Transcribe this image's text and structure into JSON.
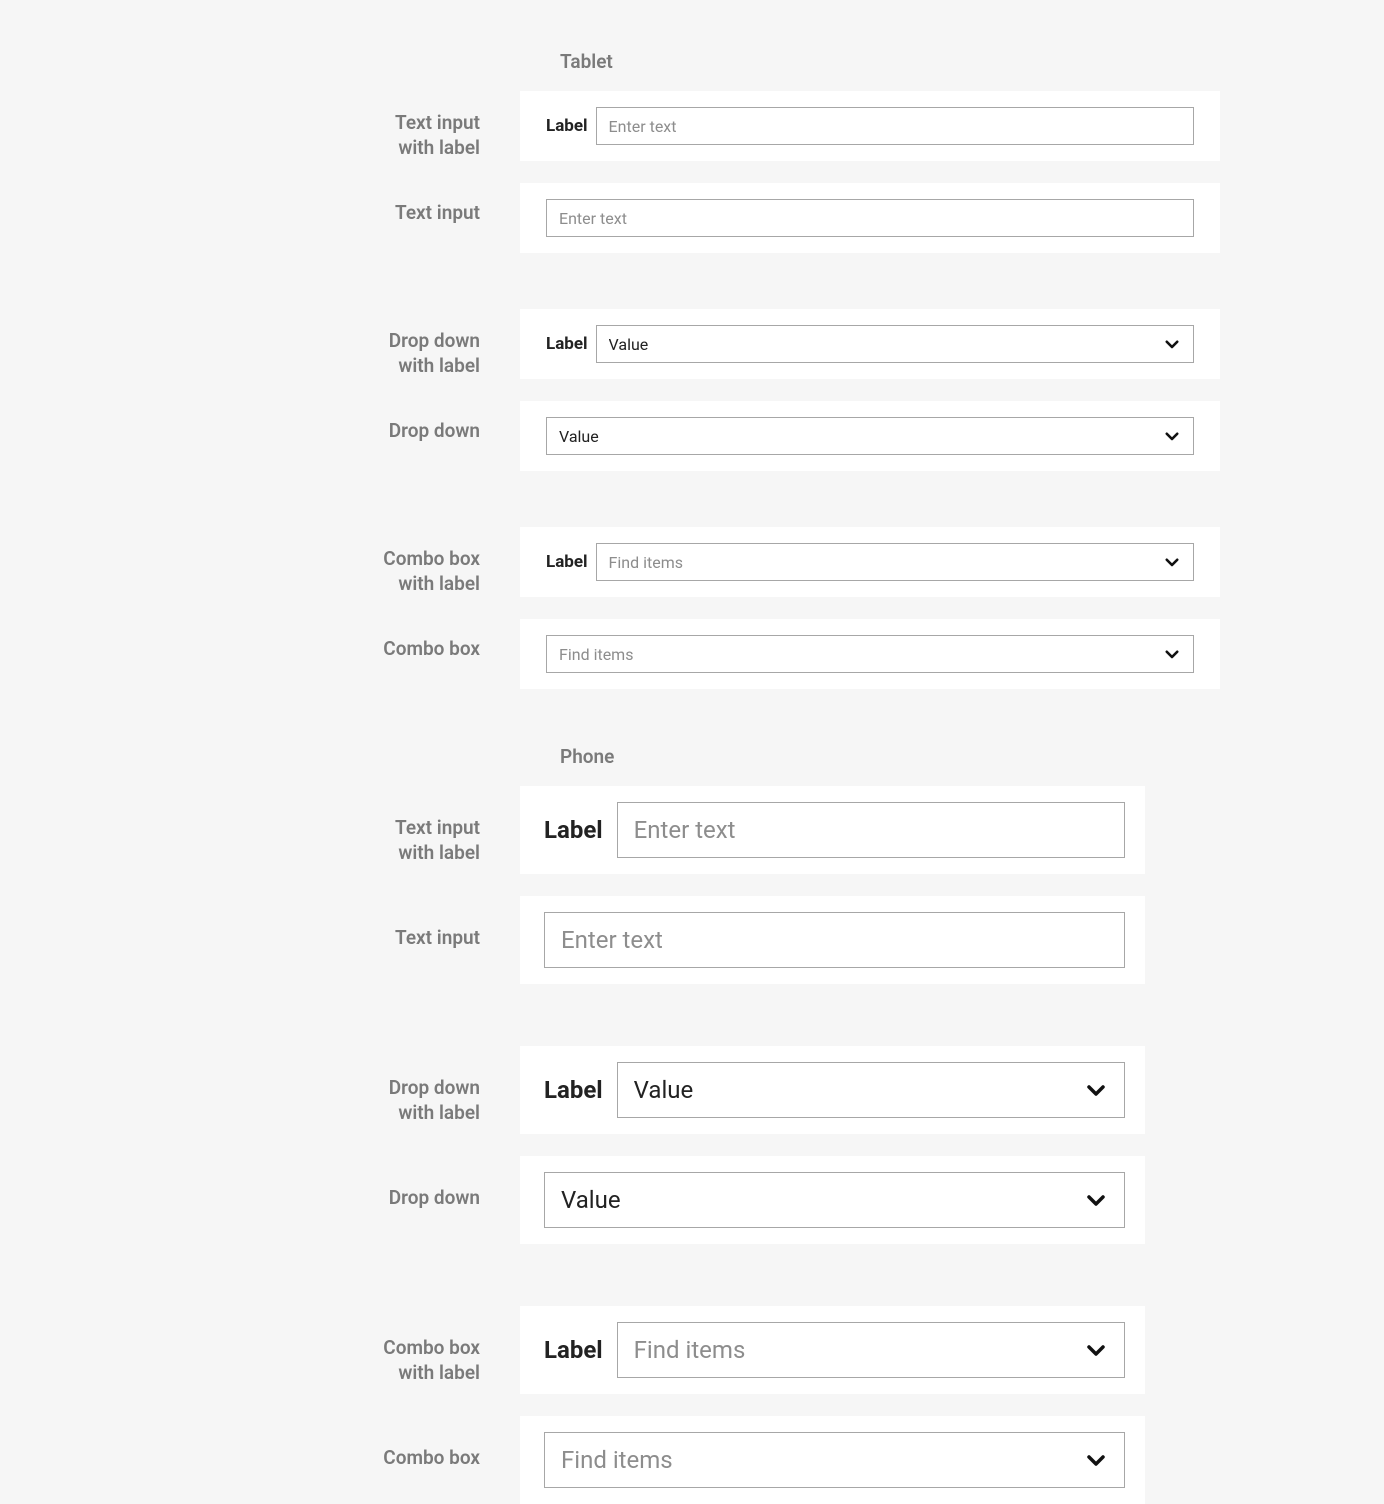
{
  "sections": {
    "tablet": {
      "heading": "Tablet"
    },
    "phone": {
      "heading": "Phone"
    }
  },
  "rowLabels": {
    "textInputWithLabel_l1": "Text input",
    "textInputWithLabel_l2": "with label",
    "textInput": "Text input",
    "dropDownWithLabel_l1": "Drop down",
    "dropDownWithLabel_l2": "with label",
    "dropDown": "Drop down",
    "comboBoxWithLabel_l1": "Combo box",
    "comboBoxWithLabel_l2": "with label",
    "comboBox": "Combo box"
  },
  "field": {
    "label": "Label",
    "textPlaceholder": "Enter text",
    "dropdownValue": "Value",
    "comboPlaceholder": "Find items"
  }
}
